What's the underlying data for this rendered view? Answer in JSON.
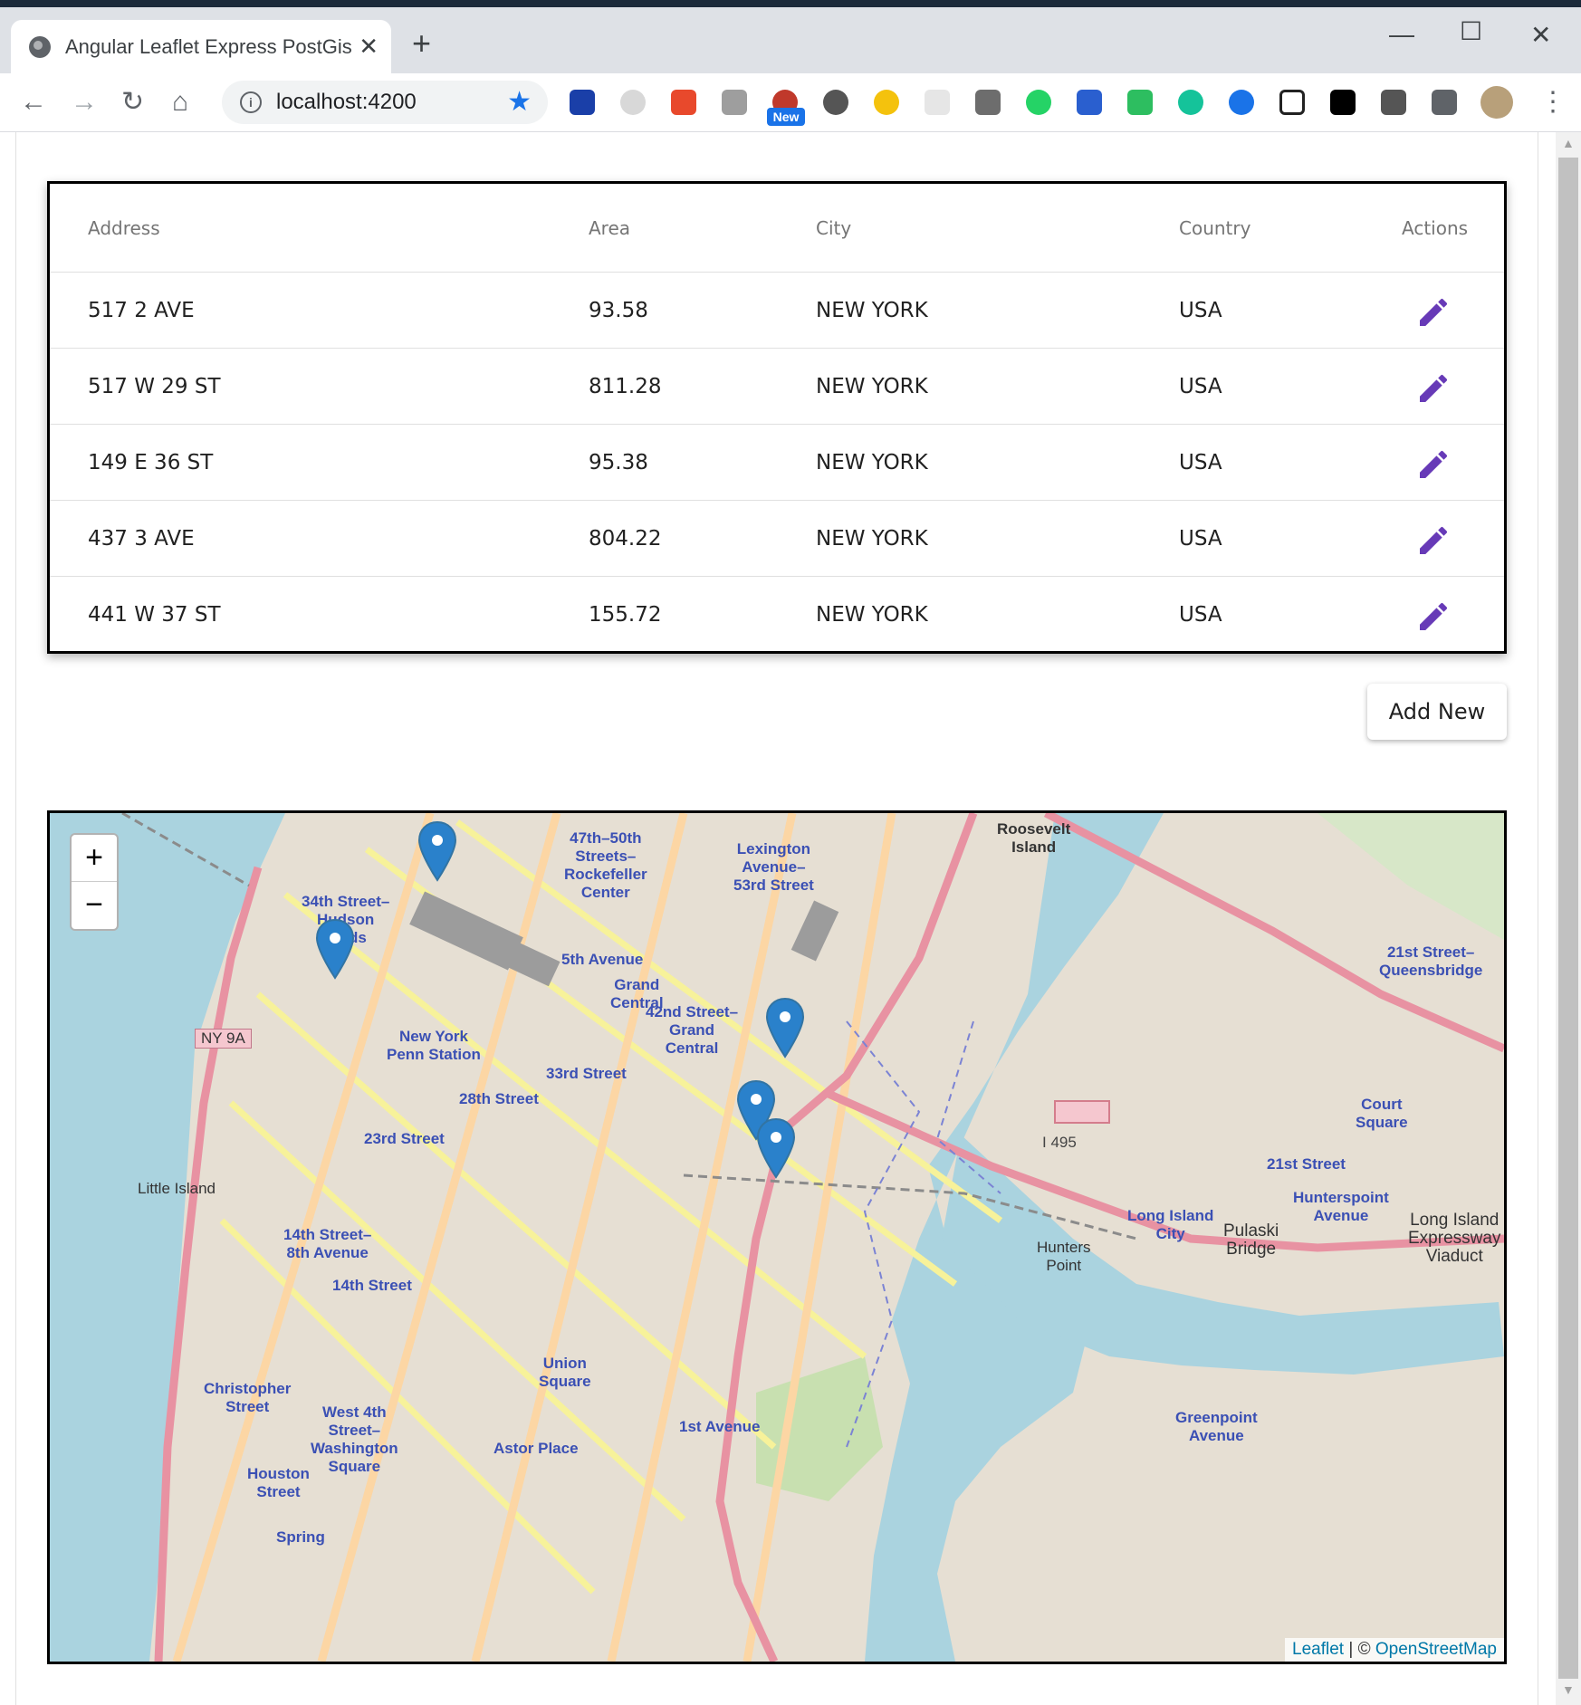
{
  "browser": {
    "tab_title": "Angular Leaflet Express PostGis D",
    "url": "localhost:4200",
    "new_badge": "New"
  },
  "table": {
    "headers": {
      "address": "Address",
      "area": "Area",
      "city": "City",
      "country": "Country",
      "actions": "Actions"
    },
    "rows": [
      {
        "address": "517 2 AVE",
        "area": "93.58",
        "city": "NEW YORK",
        "country": "USA"
      },
      {
        "address": "517 W 29 ST",
        "area": "811.28",
        "city": "NEW YORK",
        "country": "USA"
      },
      {
        "address": "149 E 36 ST",
        "area": "95.38",
        "city": "NEW YORK",
        "country": "USA"
      },
      {
        "address": "437 3 AVE",
        "area": "804.22",
        "city": "NEW YORK",
        "country": "USA"
      },
      {
        "address": "441 W 37 ST",
        "area": "155.72",
        "city": "NEW YORK",
        "country": "USA"
      }
    ]
  },
  "add_button": "Add New",
  "map": {
    "zoom_in": "+",
    "zoom_out": "−",
    "attribution_leaflet": "Leaflet",
    "attribution_sep": " | © ",
    "attribution_osm": "OpenStreetMap",
    "labels": {
      "l1": "47th–50th\nStreets–\nRockefeller\nCenter",
      "l2": "Lexington\nAvenue–\n53rd Street",
      "l3": "Roosevelt\nIsland",
      "l4": "34th Street–\nHudson\nYards",
      "l5": "5th Avenue",
      "l6": "Grand\nCentral",
      "l7": "42nd Street–\nGrand\nCentral",
      "l8": "21st Street–\nQueensbridge",
      "l9": "New York\nPenn Station",
      "l10": "33rd Street",
      "l11": "28th Street",
      "l12": "23rd Street",
      "l13": "Little Island",
      "l14": "I 495",
      "l15": "Court\nSquare",
      "l16": "21st Street",
      "l17": "Long Island\nCity",
      "l18": "Hunterspoint\nAvenue",
      "l19": "Pulaski\nBridge",
      "l20": "Hunters\nPoint",
      "l21": "14th Street–\n8th Avenue",
      "l22": "14th Street",
      "l23": "Union\nSquare",
      "l24": "Christopher\nStreet",
      "l25": "West 4th\nStreet–\nWashington\nSquare",
      "l26": "Astor Place",
      "l27": "1st Avenue",
      "l28": "Greenpoint\nAvenue",
      "l29": "Houston\nStreet",
      "l30": "Spring",
      "l31": "NY 9A",
      "l32": "Long Island\nExpressway\nViaduct"
    }
  }
}
